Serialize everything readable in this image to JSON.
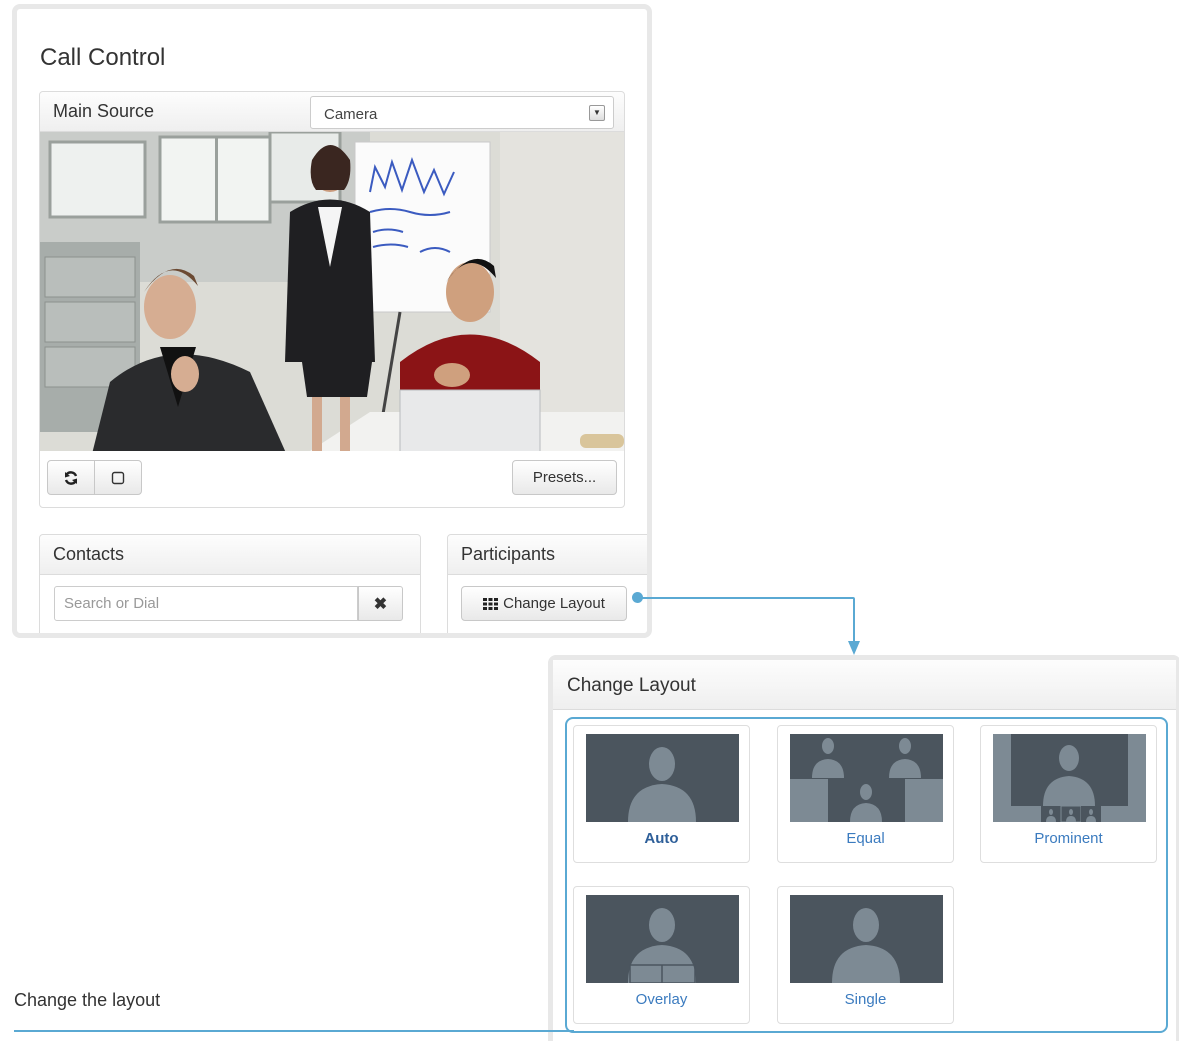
{
  "call_control": {
    "title": "Call Control",
    "main_source": {
      "label": "Main Source",
      "select_value": "Camera"
    },
    "controls": {
      "refresh_icon": "refresh-icon",
      "square_icon": "square-icon",
      "presets_label": "Presets..."
    },
    "contacts": {
      "title": "Contacts",
      "search_placeholder": "Search or Dial",
      "clear_icon": "close-icon"
    },
    "participants": {
      "title": "Participants",
      "change_layout_label": "Change Layout",
      "grid_icon": "grid-icon"
    }
  },
  "change_layout": {
    "title": "Change Layout",
    "options": [
      {
        "label": "Auto",
        "selected": true
      },
      {
        "label": "Equal",
        "selected": false
      },
      {
        "label": "Prominent",
        "selected": false
      },
      {
        "label": "Overlay",
        "selected": false
      },
      {
        "label": "Single",
        "selected": false
      }
    ]
  },
  "caption": "Change the layout",
  "colors": {
    "accent": "#5aa9d3",
    "link": "#3b7bbf",
    "thumb_bg": "#4b555e"
  }
}
